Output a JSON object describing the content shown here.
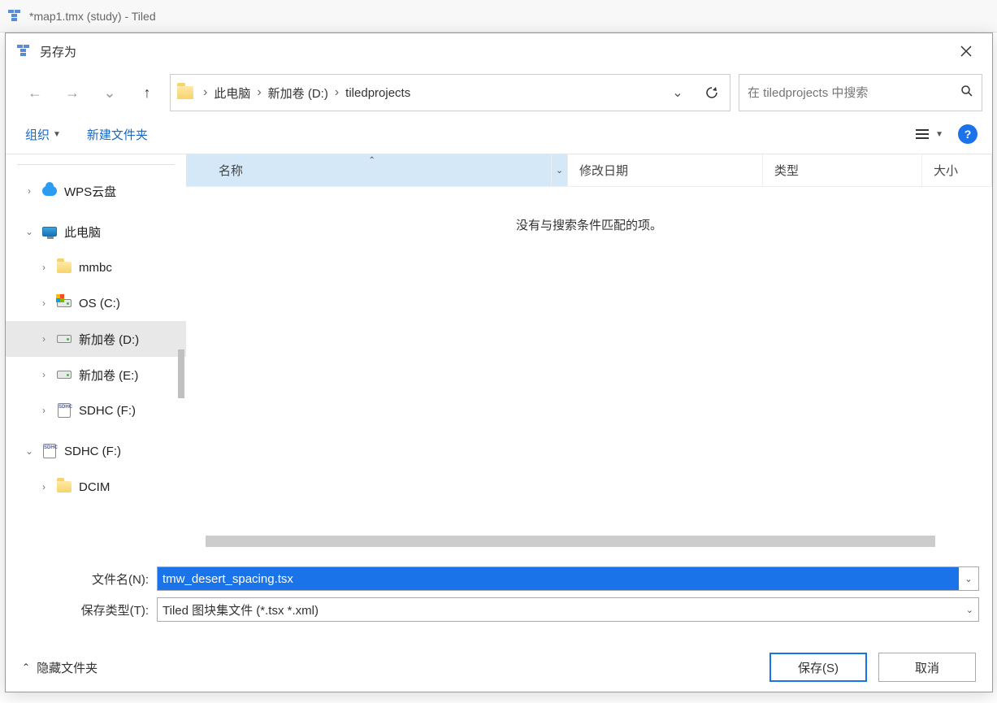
{
  "app": {
    "title": "*map1.tmx (study) - Tiled"
  },
  "dialog": {
    "title": "另存为",
    "path": {
      "seg1": "此电脑",
      "seg2": "新加卷 (D:)",
      "seg3": "tiledprojects"
    },
    "search": {
      "placeholder": "在 tiledprojects 中搜索"
    },
    "toolbar": {
      "organize": "组织",
      "newfolder": "新建文件夹"
    },
    "columns": {
      "name": "名称",
      "date": "修改日期",
      "type": "类型",
      "size": "大小"
    },
    "empty": "没有与搜索条件匹配的项。",
    "fields": {
      "filename_label": "文件名(N):",
      "filename_value": "tmw_desert_spacing.tsx",
      "filetype_label": "保存类型(T):",
      "filetype_value": "Tiled 图块集文件 (*.tsx *.xml)"
    },
    "footer": {
      "hide": "隐藏文件夹",
      "save": "保存(S)",
      "cancel": "取消"
    }
  },
  "tree": {
    "wps": "WPS云盘",
    "thispc": "此电脑",
    "mmbc": "mmbc",
    "osc": "OS (C:)",
    "d": "新加卷 (D:)",
    "e": "新加卷 (E:)",
    "sdhc_f": "SDHC (F:)",
    "sdhc_f2": "SDHC (F:)",
    "dcim": "DCIM"
  }
}
